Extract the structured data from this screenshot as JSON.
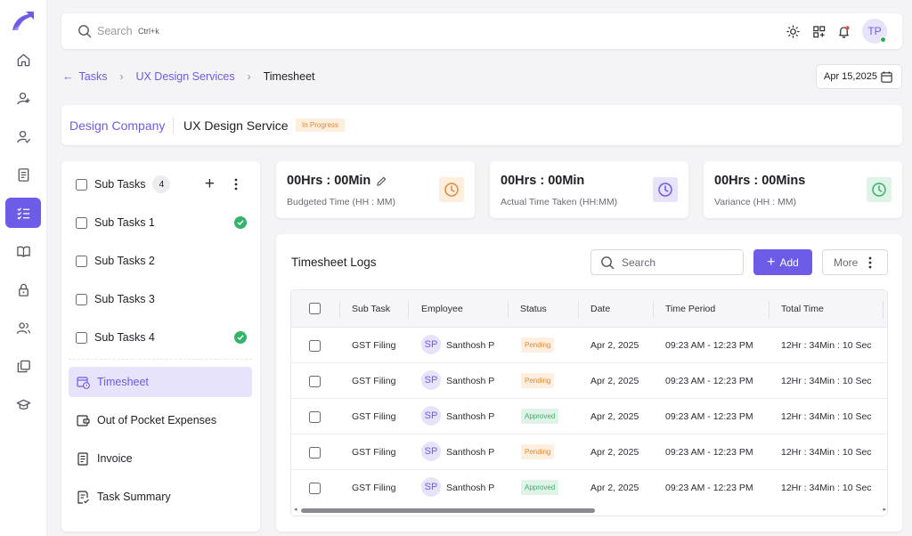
{
  "search": {
    "placeholder": "Search",
    "shortcut": "Ctrl+k"
  },
  "user": {
    "initials": "TP",
    "status_color": "#27ae60"
  },
  "rail": [
    {
      "name": "home-icon",
      "active": false
    },
    {
      "name": "add-user-icon",
      "active": false
    },
    {
      "name": "user-check-icon",
      "active": false
    },
    {
      "name": "document-icon",
      "active": false
    },
    {
      "name": "task-list-icon",
      "active": true
    },
    {
      "name": "book-icon",
      "active": false
    },
    {
      "name": "lock-icon",
      "active": false
    },
    {
      "name": "users-icon",
      "active": false
    },
    {
      "name": "copy-icon",
      "active": false
    },
    {
      "name": "graduation-cap-icon",
      "active": false
    }
  ],
  "breadcrumb": {
    "items": [
      "Tasks",
      "UX Design Services",
      "Timesheet"
    ]
  },
  "date_picker": {
    "value": "Apr 15,2025"
  },
  "header": {
    "company": "Design Company",
    "service": "UX Design Service",
    "status": "In Progress"
  },
  "sidebar": {
    "subtasks_label": "Sub Tasks",
    "subtasks_count": "4",
    "subtasks": [
      {
        "label": "Sub Tasks 1",
        "done": true
      },
      {
        "label": "Sub Tasks 2",
        "done": false
      },
      {
        "label": "Sub Tasks 3",
        "done": false
      },
      {
        "label": "Sub Tasks 4",
        "done": true
      }
    ],
    "nav": [
      {
        "label": "Timesheet",
        "icon": "calendar-clock-icon",
        "active": true
      },
      {
        "label": "Out of Pocket Expenses",
        "icon": "wallet-icon",
        "active": false
      },
      {
        "label": "Invoice",
        "icon": "invoice-icon",
        "active": false
      },
      {
        "label": "Task Summary",
        "icon": "summary-icon",
        "active": false
      }
    ]
  },
  "stats": [
    {
      "value": "00Hrs : 00Min",
      "label": "Budgeted Time (HH : MM)",
      "editable": true,
      "icon": "clock-icon",
      "color": "#e08a3c",
      "bg": "#fdeedd"
    },
    {
      "value": "00Hrs : 00Min",
      "label": "Actual Time Taken (HH:MM)",
      "editable": false,
      "icon": "clock-icon",
      "color": "#6c5ce7",
      "bg": "#e6e3fa"
    },
    {
      "value": "00Hrs : 00Mins",
      "label": "Variance (HH : MM)",
      "editable": false,
      "icon": "clock-icon",
      "color": "#34b36b",
      "bg": "#dff3e6"
    }
  ],
  "logs": {
    "title": "Timesheet Logs",
    "search_placeholder": "Search",
    "add_label": "Add",
    "more_label": "More",
    "columns": [
      "Sub Task",
      "Employee",
      "Status",
      "Date",
      "Time Period",
      "Total Time"
    ],
    "rows": [
      {
        "subtask": "GST Filing",
        "initials": "SP",
        "employee": "Santhosh P",
        "status": "Pending",
        "date": "Apr 2, 2025",
        "period": "09:23 AM - 12:23 PM",
        "total": "12Hr : 34Min : 10 Sec"
      },
      {
        "subtask": "GST Filing",
        "initials": "SP",
        "employee": "Santhosh P",
        "status": "Pending",
        "date": "Apr 2, 2025",
        "period": "09:23 AM - 12:23 PM",
        "total": "12Hr : 34Min : 10 Sec"
      },
      {
        "subtask": "GST Filing",
        "initials": "SP",
        "employee": "Santhosh P",
        "status": "Approved",
        "date": "Apr 2, 2025",
        "period": "09:23 AM - 12:23 PM",
        "total": "12Hr : 34Min : 10 Sec"
      },
      {
        "subtask": "GST Filing",
        "initials": "SP",
        "employee": "Santhosh P",
        "status": "Pending",
        "date": "Apr 2, 2025",
        "period": "09:23 AM - 12:23 PM",
        "total": "12Hr : 34Min : 10 Sec"
      },
      {
        "subtask": "GST Filing",
        "initials": "SP",
        "employee": "Santhosh P",
        "status": "Approved",
        "date": "Apr 2, 2025",
        "period": "09:23 AM - 12:23 PM",
        "total": "12Hr : 34Min : 10 Sec"
      }
    ]
  },
  "colors": {
    "accent": "#6c5ce7",
    "pending_text": "#e08a3c",
    "pending_bg": "#fdeedd",
    "approved_text": "#34b36b",
    "approved_bg": "#dff3e6"
  }
}
